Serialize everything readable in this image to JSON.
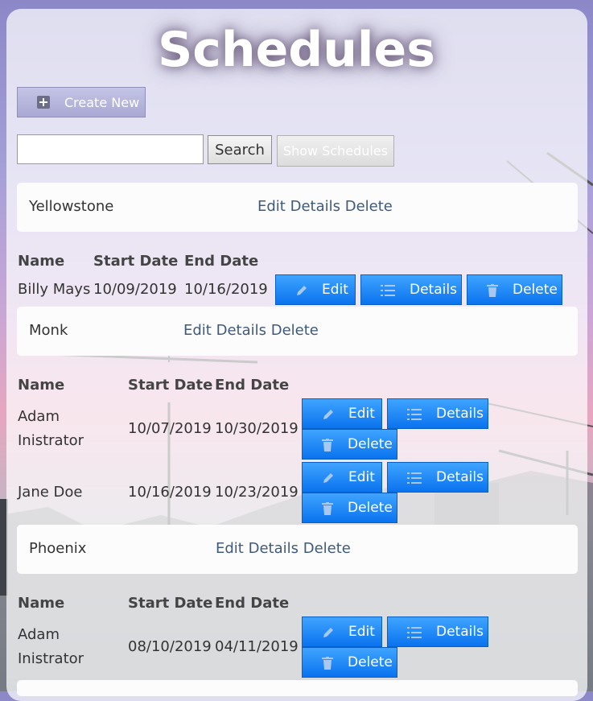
{
  "page": {
    "title": "Schedules"
  },
  "toolbar": {
    "create_label": "Create New",
    "search_value": "",
    "search_label": "Search",
    "show_label": "Show Schedules"
  },
  "link_labels": {
    "edit": "Edit",
    "details": "Details",
    "delete": "Delete"
  },
  "table_headers": {
    "name": "Name",
    "start": "Start Date",
    "end": "End Date"
  },
  "button_labels": {
    "edit": "Edit",
    "details": "Details",
    "delete": "Delete"
  },
  "schedules": [
    {
      "name": "Yellowstone",
      "rows": [
        {
          "name": "Billy Mays",
          "start": "10/09/2019",
          "end": "10/16/2019"
        }
      ]
    },
    {
      "name": "Monk",
      "rows": [
        {
          "name_line1": "Adam",
          "name_line2": "Inistrator",
          "start": "10/07/2019",
          "end": "10/30/2019"
        },
        {
          "name": "Jane Doe",
          "start": "10/16/2019",
          "end": "10/23/2019"
        }
      ]
    },
    {
      "name": "Phoenix",
      "rows": [
        {
          "name_line1": "Adam",
          "name_line2": "Inistrator",
          "start": "08/10/2019",
          "end": "04/11/2019"
        }
      ]
    }
  ],
  "colors": {
    "button_blue": "#0a73ee",
    "link": "#3f5a7a"
  }
}
